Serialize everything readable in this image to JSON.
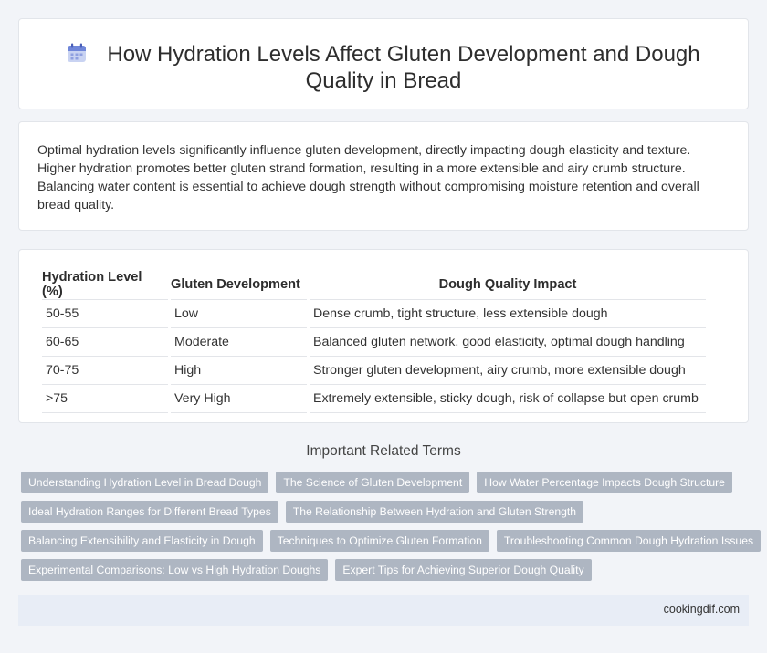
{
  "header": {
    "title": "How Hydration Levels Affect Gluten Development and Dough Quality in Bread",
    "icon": "calendar-icon"
  },
  "summary": {
    "text": "Optimal hydration levels significantly influence gluten development, directly impacting dough elasticity and texture. Higher hydration promotes better gluten strand formation, resulting in a more extensible and airy crumb structure. Balancing water content is essential to achieve dough strength without compromising moisture retention and overall bread quality."
  },
  "table": {
    "headers": [
      "Hydration Level (%)",
      "Gluten Development",
      "Dough Quality Impact"
    ],
    "rows": [
      [
        "50-55",
        "Low",
        "Dense crumb, tight structure, less extensible dough"
      ],
      [
        "60-65",
        "Moderate",
        "Balanced gluten network, good elasticity, optimal dough handling"
      ],
      [
        "70-75",
        "High",
        "Stronger gluten development, airy crumb, more extensible dough"
      ],
      [
        ">75",
        "Very High",
        "Extremely extensible, sticky dough, risk of collapse but open crumb"
      ]
    ]
  },
  "related": {
    "title": "Important Related Terms",
    "rows": [
      [
        "Understanding Hydration Level in Bread Dough",
        "The Science of Gluten Development",
        "How Water Percentage Impacts Dough Structure"
      ],
      [
        "Ideal Hydration Ranges for Different Bread Types",
        "The Relationship Between Hydration and Gluten Strength"
      ],
      [
        "Balancing Extensibility and Elasticity in Dough",
        "Techniques to Optimize Gluten Formation",
        "Troubleshooting Common Dough Hydration Issues"
      ],
      [
        "Experimental Comparisons: Low vs High Hydration Doughs",
        "Expert Tips for Achieving Superior Dough Quality"
      ]
    ]
  },
  "footer": {
    "site": "cookingdif.com"
  },
  "colors": {
    "tag_background": "#aeb6c2",
    "footer_background": "#e8edf6",
    "page_background": "#f2f4f8"
  }
}
